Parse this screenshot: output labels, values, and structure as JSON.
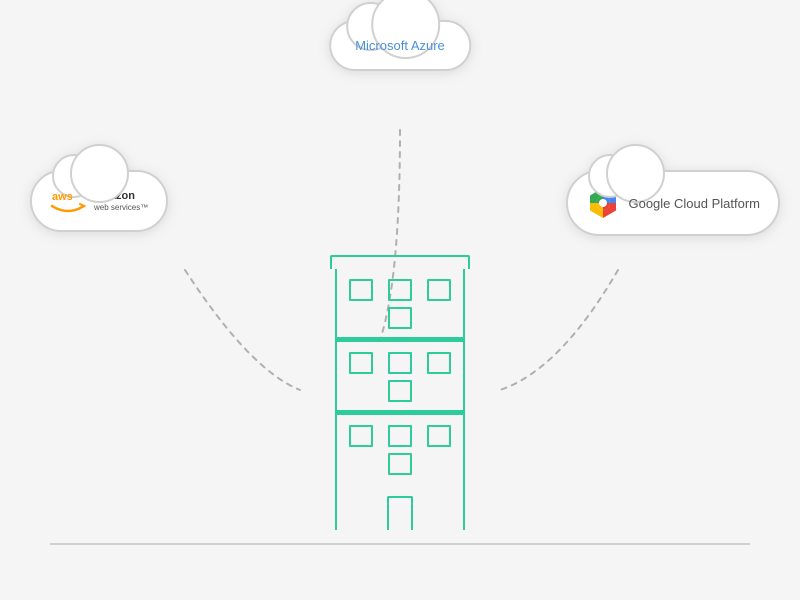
{
  "scene": {
    "background_color": "#f5f5f5"
  },
  "clouds": {
    "azure": {
      "label": "Microsoft Azure",
      "position": "top-center"
    },
    "aws": {
      "label": "amazon\nweb services",
      "label_main": "amazon",
      "label_sub": "web services™",
      "position": "left"
    },
    "gcp": {
      "label": "Google Cloud Platform",
      "position": "right"
    }
  },
  "building": {
    "floors": 3,
    "windows_per_floor": 4,
    "color": "#2ecc9a"
  },
  "connections": {
    "style": "dotted",
    "color": "#aaaaaa"
  }
}
